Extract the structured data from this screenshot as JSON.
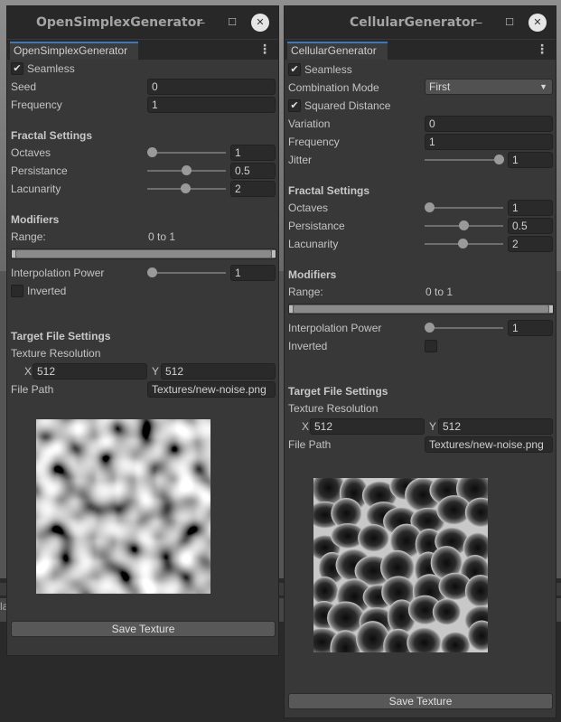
{
  "left_panel": {
    "title": "OpenSimplexGenerator",
    "tab": "OpenSimplexGenerator",
    "seamless_label": "Seamless",
    "seed_label": "Seed",
    "seed_value": "0",
    "frequency_label": "Frequency",
    "frequency_value": "1",
    "fractal_header": "Fractal Settings",
    "octaves_label": "Octaves",
    "octaves_value": "1",
    "persistance_label": "Persistance",
    "persistance_value": "0.5",
    "lacunarity_label": "Lacunarity",
    "lacunarity_value": "2",
    "modifiers_header": "Modifiers",
    "range_label": "Range:",
    "range_value": "0 to 1",
    "interp_label": "Interpolation Power",
    "interp_value": "1",
    "inverted_label": "Inverted",
    "target_header": "Target File Settings",
    "texres_label": "Texture Resolution",
    "x_label": "X",
    "x_value": "512",
    "y_label": "Y",
    "y_value": "512",
    "filepath_label": "File Path",
    "filepath_value": "Textures/new-noise.png",
    "save_button": "Save Texture"
  },
  "right_panel": {
    "title": "CellularGenerator",
    "tab": "CellularGenerator",
    "seamless_label": "Seamless",
    "combination_label": "Combination Mode",
    "combination_value": "First",
    "squared_label": "Squared Distance",
    "variation_label": "Variation",
    "variation_value": "0",
    "frequency_label": "Frequency",
    "frequency_value": "1",
    "jitter_label": "Jitter",
    "jitter_value": "1",
    "fractal_header": "Fractal Settings",
    "octaves_label": "Octaves",
    "octaves_value": "1",
    "persistance_label": "Persistance",
    "persistance_value": "0.5",
    "lacunarity_label": "Lacunarity",
    "lacunarity_value": "2",
    "modifiers_header": "Modifiers",
    "range_label": "Range:",
    "range_value": "0 to 1",
    "interp_label": "Interpolation Power",
    "interp_value": "1",
    "inverted_label": "Inverted",
    "target_header": "Target File Settings",
    "texres_label": "Texture Resolution",
    "x_label": "X",
    "x_value": "512",
    "y_label": "Y",
    "y_value": "512",
    "filepath_label": "File Path",
    "filepath_value": "Textures/new-noise.png",
    "save_button": "Save Texture"
  },
  "icons": {
    "minimize": "minimize-icon",
    "maximize": "maximize-icon",
    "close": "close-icon",
    "menu": "kebab-menu-icon",
    "check": "checkmark-icon",
    "dropdown": "dropdown-arrow-icon"
  },
  "colors": {
    "panel": "#383838",
    "titlebar": "#282828",
    "tab_accent": "#3a79bb",
    "field": "#2a2a2a"
  }
}
